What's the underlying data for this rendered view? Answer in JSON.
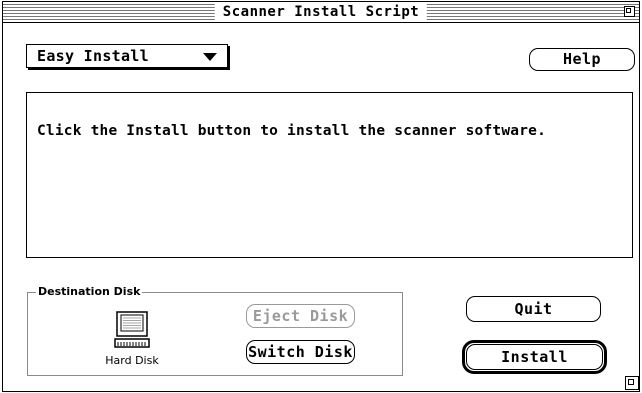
{
  "window": {
    "title": "Scanner Install Script"
  },
  "install_type": {
    "selected": "Easy Install"
  },
  "buttons": {
    "help": "Help",
    "eject_disk": "Eject Disk",
    "switch_disk": "Switch Disk",
    "quit": "Quit",
    "install": "Install"
  },
  "message": "Click the Install button to install the scanner software.",
  "destination": {
    "group_label": "Destination Disk",
    "disk_name": "Hard Disk"
  },
  "icons": {
    "disk": "hard-disk-icon",
    "popup_arrow": "triangle-down-icon",
    "zoom": "zoom-box-icon",
    "grow": "grow-box-icon"
  }
}
